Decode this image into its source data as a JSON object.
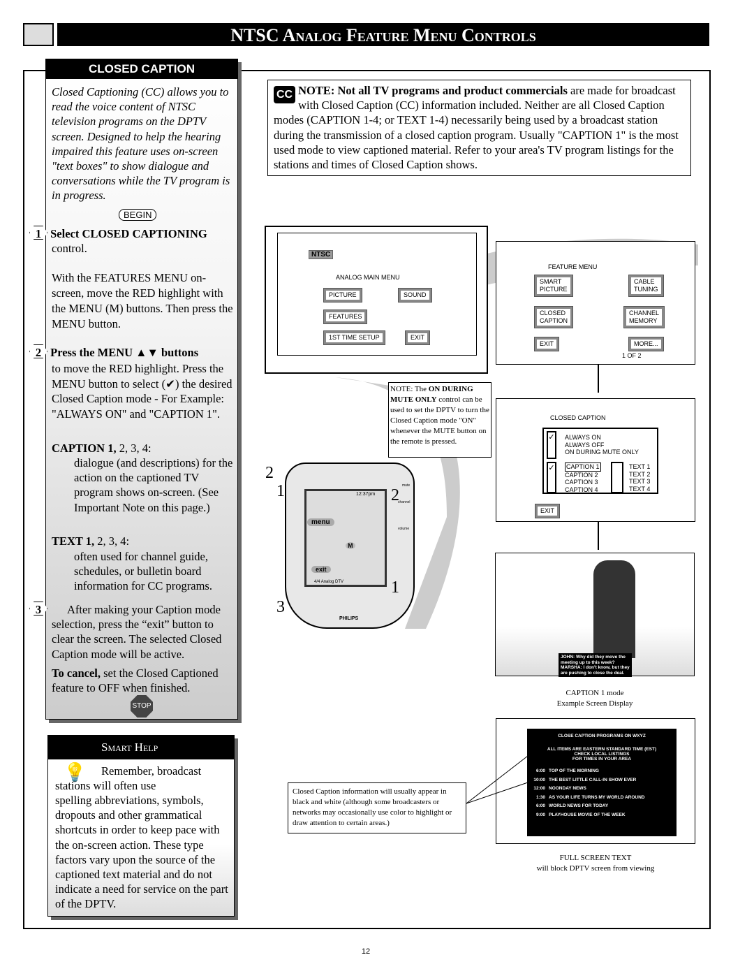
{
  "header": {
    "title": "NTSC Analog Feature Menu Controls",
    "logo_icon": "tv-book-icon"
  },
  "left": {
    "heading": "CLOSED CAPTION",
    "intro": "Closed Captioning (CC) allows you to read the voice content of NTSC television programs on the DPTV screen. Designed to help the hearing impaired this feature uses on-screen \"text boxes\" to show dialogue and conversations while the TV program is in progress.",
    "begin": "BEGIN",
    "step1_num": "1",
    "step1_title": "Select CLOSED CAPTIONING",
    "step1_text": "control.",
    "step1_body": "With the FEATURES MENU on-screen, move the RED highlight with the MENU (M) buttons. Then press the MENU button.",
    "step2_num": "2",
    "step2_title": "Press the MENU ▲▼ buttons",
    "step2_text": "to move the RED highlight. Press the MENU button to select (✔) the desired Closed Caption mode - For Example: \"ALWAYS ON\" and \"CAPTION 1\".",
    "caption_head": "CAPTION 1,",
    "caption_head2": " 2, 3, 4:",
    "caption_body": "dialogue (and descriptions) for the action on the captioned TV program shows on-screen. (See Important Note on this page.)",
    "text_head": "TEXT 1,",
    "text_head2": " 2, 3, 4:",
    "text_body": "often used for channel guide, schedules, or bulletin board information for CC programs.",
    "step3_num": "3",
    "step3_text": "After making your Caption mode selection, press the “exit” button to clear the screen. The selected Closed Caption mode will be active.",
    "cancel_bold": "To cancel,",
    "cancel_text": " set the Closed Captioned feature to OFF when finished.",
    "stop": "STOP"
  },
  "help": {
    "title": "Smart Help",
    "text_first": "Remember, broadcast stations will often use",
    "text_rest": "spelling abbreviations, symbols, dropouts and other grammatical shortcuts in order to keep pace with the on-screen action. These type factors vary upon the source of the captioned text material and do not indicate a need for service on the part of the DPTV."
  },
  "note": {
    "badge": "CC",
    "bold": "NOTE: Not all TV programs and product commercials",
    "text": " are made for broadcast with Closed Caption (CC) information included. Neither are all Closed Caption modes (CAPTION 1-4; or TEXT 1-4) necessarily being used by a broadcast station during the transmission of a closed caption program. Usually \"CAPTION 1\" is the most used mode to view captioned material. Refer to your area's TV program listings for the stations and times of Closed Caption shows."
  },
  "main_menu": {
    "badge": "NTSC",
    "title": "ANALOG MAIN MENU",
    "picture": "PICTURE",
    "sound": "SOUND",
    "features": "FEATURES",
    "setup": "1ST TIME SETUP",
    "exit": "EXIT"
  },
  "feature_menu": {
    "title": "FEATURE MENU",
    "smart1": "SMART",
    "smart2": "PICTURE",
    "cable1": "CABLE",
    "cable2": "TUNING",
    "cc1": "CLOSED",
    "cc2": "CAPTION",
    "chan1": "CHANNEL",
    "chan2": "MEMORY",
    "exit": "EXIT",
    "more": "MORE...",
    "page": "1 OF 2"
  },
  "mute_note": {
    "t1": "NOTE: The ",
    "b1": "ON DURING MUTE ONLY",
    "t2": " control can be used to set the DPTV to turn the Closed Caption mode \"ON\" whenever the MUTE button on the remote is pressed."
  },
  "cc_menu": {
    "title": "CLOSED CAPTION",
    "modes": [
      "ALWAYS ON",
      "ALWAYS OFF",
      "ON DURING MUTE ONLY"
    ],
    "captions": [
      "CAPTION 1",
      "CAPTION 2",
      "CAPTION 3",
      "CAPTION 4"
    ],
    "texts": [
      "TEXT 1",
      "TEXT 2",
      "TEXT 3",
      "TEXT 4"
    ],
    "exit": "EXIT"
  },
  "remote": {
    "time": "12:37pm",
    "menu": "menu",
    "m": "M",
    "exit": "exit",
    "analog": "Analog",
    "dtv": "DTV",
    "ch": "4/4",
    "mute": "mute",
    "channel": "channel",
    "volume": "volume",
    "brand": "PHILIPS",
    "callouts": [
      "2",
      "1",
      "2",
      "1",
      "3"
    ]
  },
  "example": {
    "caption_lines": [
      "JOHN: Why did they move  the",
      "meeting up to this week?",
      "MARSHA: I don't know, but they",
      "are pushing to close the deal."
    ],
    "label1": "CAPTION 1 mode",
    "label2": "Example Screen Display"
  },
  "fullscreen": {
    "title": "CLOSE CAPTION PROGRAMS ON WXYZ",
    "notice": [
      "ALL ITEMS ARE EASTERN STANDARD TIME (EST)",
      "CHECK LOCAL LISTINGS",
      "FOR TIMES IN YOUR AREA"
    ],
    "programs": [
      {
        "time": "6:00",
        "name": "TOP OF THE MORNING"
      },
      {
        "time": "10:00",
        "name": "THE BEST LITTLE CALL-IN SHOW EVER"
      },
      {
        "time": "12:00",
        "name": "NOONDAY NEWS"
      },
      {
        "time": "1:30",
        "name": "AS YOUR LIFE TURNS MY WORLD AROUND"
      },
      {
        "time": "6:00",
        "name": "WORLD NEWS FOR TODAY"
      },
      {
        "time": "9:00",
        "name": "PLAYHOUSE MOVIE OF THE WEEK"
      }
    ],
    "label1": "FULL SCREEN TEXT",
    "label2": "will block DPTV screen from viewing"
  },
  "color_note": "Closed Caption information will usually appear in black and white (although some broadcasters or networks may occasionally use color to highlight or draw attention to certain areas.)",
  "page_number": "12"
}
